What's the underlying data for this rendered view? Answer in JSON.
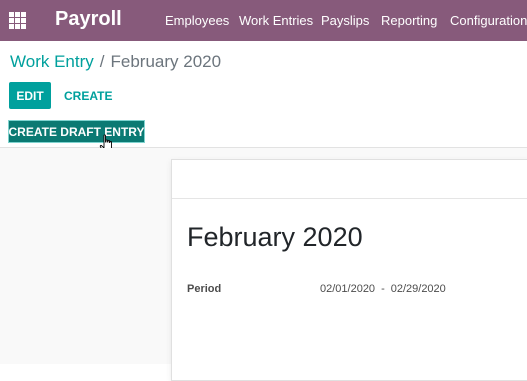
{
  "navbar": {
    "apps_icon": "apps-grid-icon",
    "app_name": "Payroll",
    "menu": [
      "Employees",
      "Work Entries",
      "Payslips",
      "Reporting",
      "Configuration"
    ]
  },
  "breadcrumb": {
    "parent": "Work Entry",
    "separator": "/",
    "current": "February 2020"
  },
  "buttons": {
    "edit": "EDIT",
    "create": "CREATE",
    "create_draft_entry": "CREATE DRAFT ENTRY"
  },
  "record": {
    "title": "February 2020",
    "period_label": "Period",
    "period_start": "02/01/2020",
    "period_separator": "-",
    "period_end": "02/29/2020"
  },
  "cursor": "hand-pointer-icon",
  "colors": {
    "navbar": "#875a7b",
    "primary": "#00a09d",
    "draft_button": "#0b7a73"
  }
}
